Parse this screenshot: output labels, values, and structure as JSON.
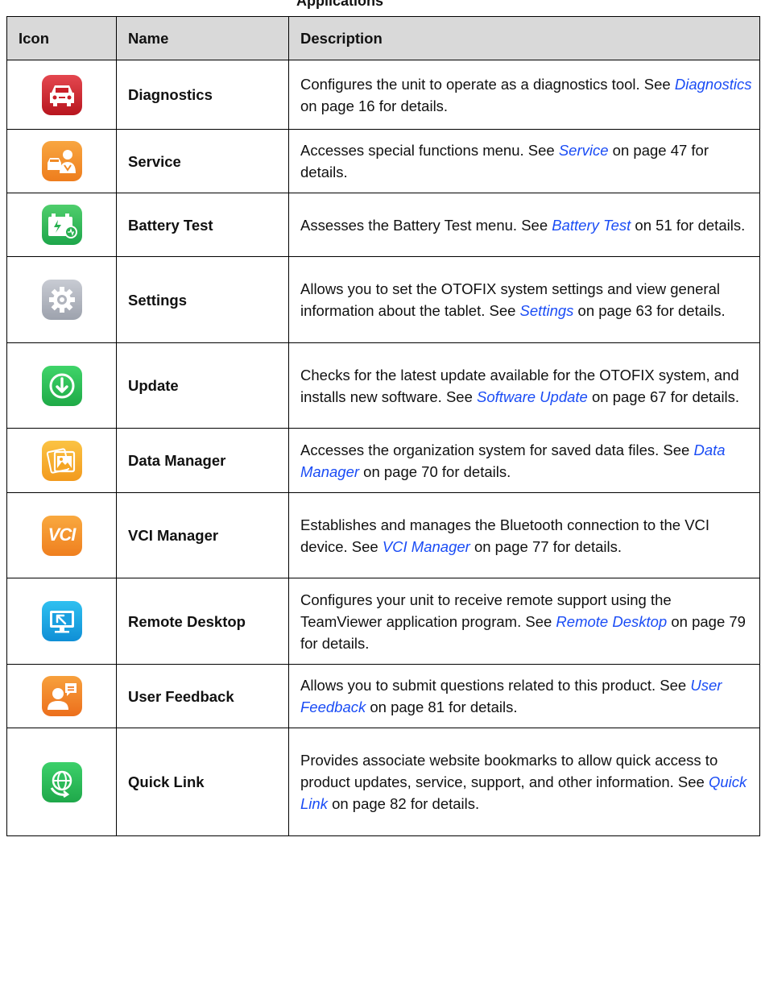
{
  "header_strip_text": "Applications",
  "columns": [
    "Icon",
    "Name",
    "Description"
  ],
  "rows": [
    {
      "icon": "car-icon",
      "name": "Diagnostics",
      "desc_pre": "Configures the unit to operate as a diagnostics tool. See ",
      "link": "Diagnostics",
      "desc_post": " on page 16 for details."
    },
    {
      "icon": "mechanic-car-icon",
      "name": "Service",
      "desc_pre": "Accesses special functions menu. See ",
      "link": "Service",
      "desc_post": " on page 47 for details."
    },
    {
      "icon": "battery-icon",
      "name": "Battery Test",
      "desc_pre": "Assesses the Battery Test menu. See ",
      "link": "Battery Test",
      "desc_post": " on 51 for details."
    },
    {
      "icon": "gear-icon",
      "name": "Settings",
      "desc_pre": "Allows you to set the OTOFIX system settings and view general information about the tablet. See ",
      "link": "Settings",
      "desc_post": " on page 63 for details."
    },
    {
      "icon": "download-arrow-icon",
      "name": "Update",
      "desc_pre": "Checks for the latest update available for the OTOFIX system, and installs new software. See ",
      "link": "Software Update",
      "desc_post": " on page 67 for details."
    },
    {
      "icon": "photo-folder-icon",
      "name": "Data Manager",
      "desc_pre": "Accesses the organization system for saved data files. See ",
      "link": "Data Manager",
      "desc_post": " on page 70 for details."
    },
    {
      "icon": "vci-icon",
      "name": "VCI Manager",
      "desc_pre": "Establishes and manages the Bluetooth connection to the VCI device. See ",
      "link": "VCI Manager",
      "desc_post": " on page 77 for details."
    },
    {
      "icon": "monitor-cursor-icon",
      "name": "Remote Desktop",
      "desc_pre": "Configures your unit to receive remote support using the TeamViewer application program. See ",
      "link": "Remote Desktop",
      "desc_post": " on page 79 for details."
    },
    {
      "icon": "user-message-icon",
      "name": "User Feedback",
      "desc_pre": "Allows you to submit questions related to this product. See ",
      "link": "User Feedback",
      "desc_post": " on page 81 for details."
    },
    {
      "icon": "globe-refresh-icon",
      "name": "Quick Link",
      "desc_pre": "Provides associate website bookmarks to allow quick access to product updates, service, support, and other information. See ",
      "link": "Quick Link",
      "desc_post": " on page 82 for details."
    }
  ],
  "icon_text": {
    "vci": "VCI"
  },
  "colors": {
    "link": "#1a4cf5",
    "header_bg": "#d9d9d9"
  }
}
